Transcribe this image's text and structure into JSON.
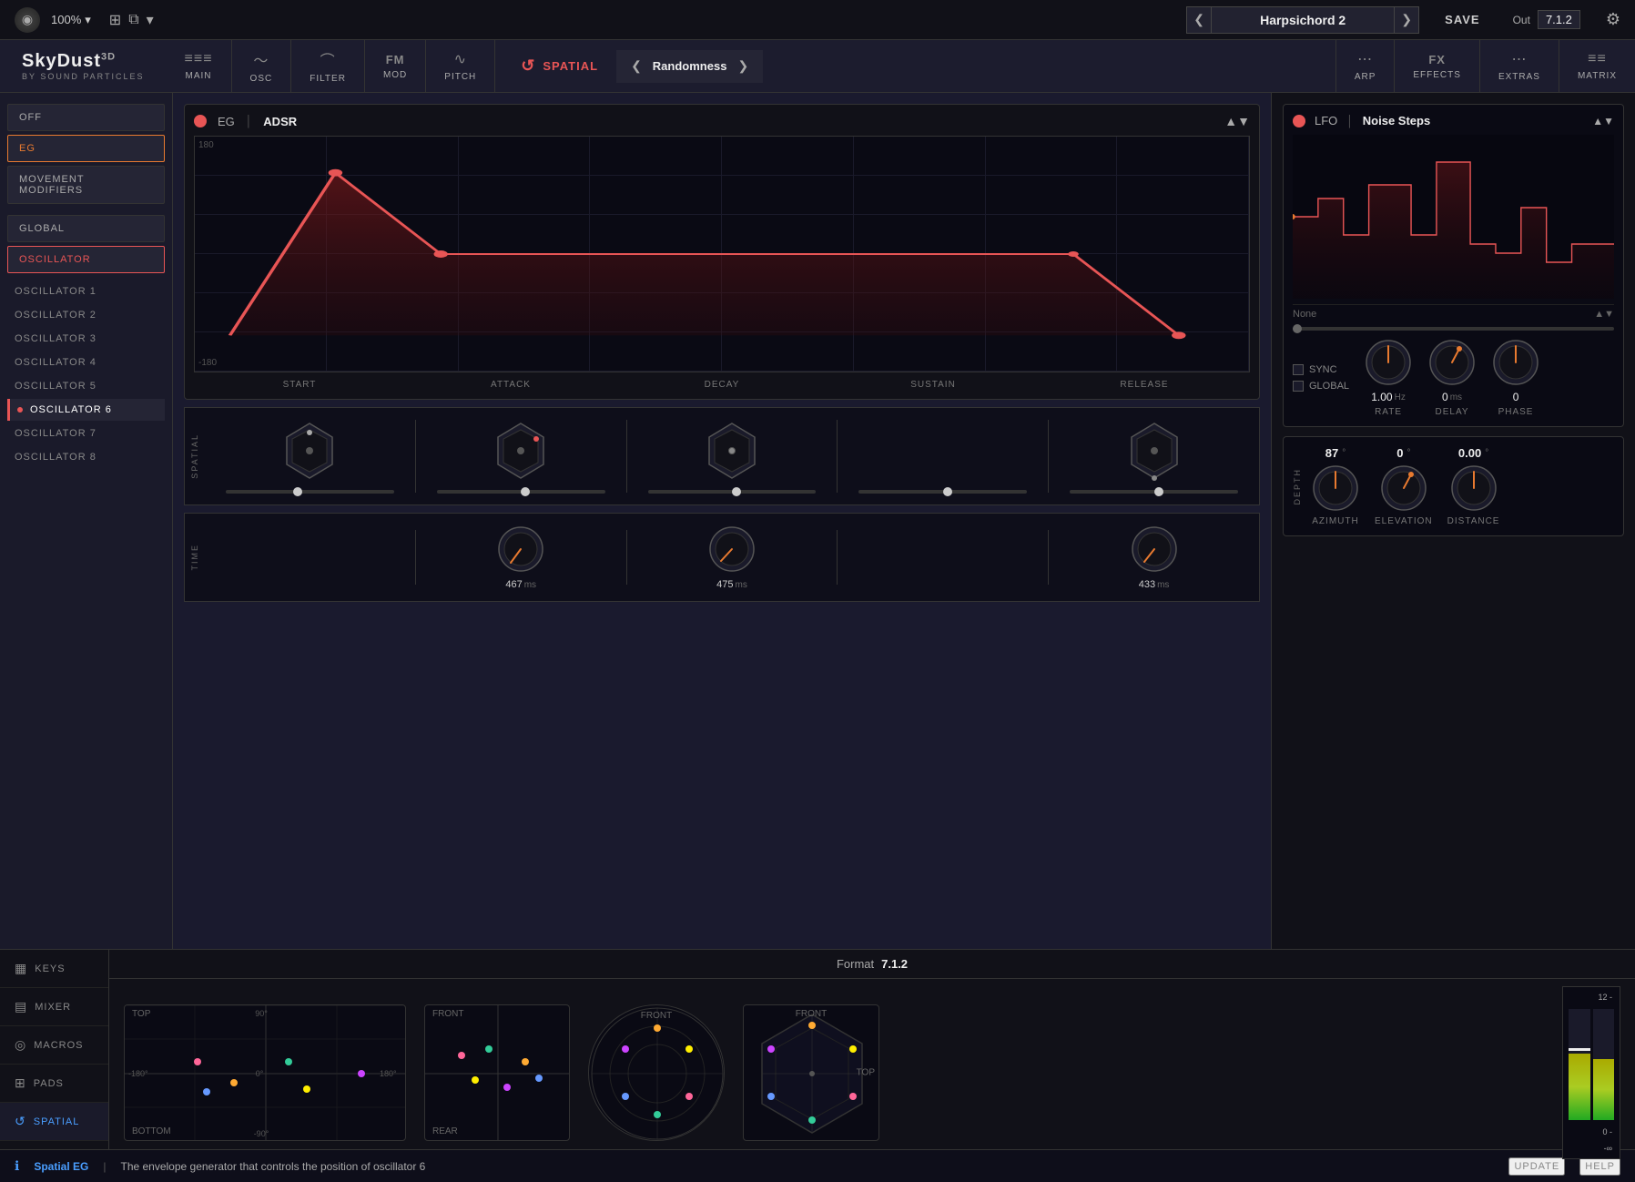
{
  "topbar": {
    "logo": "◉",
    "percent": "100%",
    "expand_icon": "⊞",
    "chevron_down": "▾",
    "prev": "❮",
    "next": "❯",
    "preset_name": "Harpsichord 2",
    "save": "SAVE",
    "out_label": "Out",
    "out_value": "7.1.2",
    "settings": "⚙"
  },
  "brand": {
    "name": "SkyDust",
    "superscript": "3D",
    "sub": "BY SOUND PARTICLES"
  },
  "nav": {
    "tabs": [
      {
        "id": "main",
        "label": "MAIN",
        "icon": "≡≡≡"
      },
      {
        "id": "osc",
        "label": "OSC",
        "icon": "〜"
      },
      {
        "id": "filter",
        "label": "FILTER",
        "icon": "⌒"
      },
      {
        "id": "mod",
        "label": "FM",
        "icon": "FM"
      },
      {
        "id": "pitch",
        "label": "PITCH",
        "icon": "∿"
      }
    ],
    "spatial": {
      "icon": "↺",
      "label": "SPATIAL"
    },
    "spatial_nav": {
      "prev": "❮",
      "label": "Randomness",
      "next": "❯"
    },
    "right_tabs": [
      {
        "id": "arp",
        "label": "ARP",
        "icon": "⋯"
      },
      {
        "id": "effects",
        "label": "EFFECTS",
        "icon": "FX"
      },
      {
        "id": "extras",
        "label": "EXTRAS",
        "icon": "⋯"
      },
      {
        "id": "matrix",
        "label": "MATRIX",
        "icon": "≡≡"
      }
    ]
  },
  "sidebar": {
    "off_btn": "OFF",
    "eg_btn": "EG",
    "movement_btn": "MOVEMENT\nMODIFIERS",
    "global_btn": "GLOBAL",
    "oscillator_btn": "OSCILLATOR",
    "oscillators": [
      {
        "label": "OSCILLATOR 1",
        "active": false
      },
      {
        "label": "OSCILLATOR 2",
        "active": false
      },
      {
        "label": "OSCILLATOR 3",
        "active": false
      },
      {
        "label": "OSCILLATOR 4",
        "active": false
      },
      {
        "label": "OSCILLATOR 5",
        "active": false
      },
      {
        "label": "OSCILLATOR 6",
        "active": true
      },
      {
        "label": "OSCILLATOR 7",
        "active": false
      },
      {
        "label": "OSCILLATOR 8",
        "active": false
      }
    ]
  },
  "eg": {
    "power": true,
    "title": "EG",
    "type": "ADSR",
    "label_180": "180",
    "label_neg180": "-180",
    "params": {
      "start": "START",
      "attack": "ATTACK",
      "decay": "DECAY",
      "sustain": "SUSTAIN",
      "release": "RELEASE"
    }
  },
  "spatial_row": {
    "label": "SPATIAL"
  },
  "time_row": {
    "label": "TIME",
    "attack_val": "467",
    "attack_unit": "ms",
    "decay_val": "475",
    "decay_unit": "ms",
    "release_val": "433",
    "release_unit": "ms"
  },
  "lfo": {
    "power": true,
    "title": "LFO",
    "type": "Noise Steps",
    "none_label": "None",
    "sync_label": "SYNC",
    "global_label": "GLOBAL",
    "rate_val": "1.00",
    "rate_unit": "Hz",
    "rate_label": "RATE",
    "delay_val": "0",
    "delay_unit": "ms",
    "delay_label": "DELAY",
    "phase_val": "0",
    "phase_unit": "",
    "phase_label": "PHASE"
  },
  "depth": {
    "label": "DEPTH",
    "azimuth_val": "87",
    "azimuth_unit": "°",
    "azimuth_label": "AZIMUTH",
    "elevation_val": "0",
    "elevation_unit": "°",
    "elevation_label": "ELEVATION",
    "distance_val": "0.00",
    "distance_unit": "°",
    "distance_label": "DISTANCE"
  },
  "bottom": {
    "tabs": [
      {
        "id": "keys",
        "label": "KEYS",
        "icon": "▦"
      },
      {
        "id": "mixer",
        "label": "MIXER",
        "icon": "▤"
      },
      {
        "id": "macros",
        "label": "MACROS",
        "icon": "◎"
      },
      {
        "id": "pads",
        "label": "PADS",
        "icon": "⊞"
      },
      {
        "id": "spatial",
        "label": "SPATIAL",
        "icon": "↺",
        "active": true
      }
    ],
    "format_label": "Format",
    "format_value": "7.1.2",
    "displays": [
      {
        "id": "top-bottom",
        "labels": [
          "TOP",
          "BOTTOM"
        ]
      },
      {
        "id": "front-rear",
        "labels": [
          "FRONT",
          "REAR"
        ]
      },
      {
        "id": "circle-1",
        "labels": [
          "FRONT"
        ]
      },
      {
        "id": "hex-top",
        "labels": [
          "FRONT",
          "TOP"
        ]
      }
    ]
  },
  "status": {
    "icon": "ℹ",
    "section": "Spatial EG",
    "sep": "|",
    "text": "The envelope generator that controls the position of oscillator 6",
    "update_btn": "UPDATE",
    "help_btn": "HELP"
  },
  "meter": {
    "label_12": "12 -",
    "label_0": "0 -",
    "label_neg_inf": "-∞"
  },
  "colors": {
    "accent_red": "#e85555",
    "accent_orange": "#e87a30",
    "accent_blue": "#4a9eff",
    "bg_dark": "#0a0a14",
    "bg_mid": "#111118",
    "bg_light": "#1a1a2a"
  }
}
